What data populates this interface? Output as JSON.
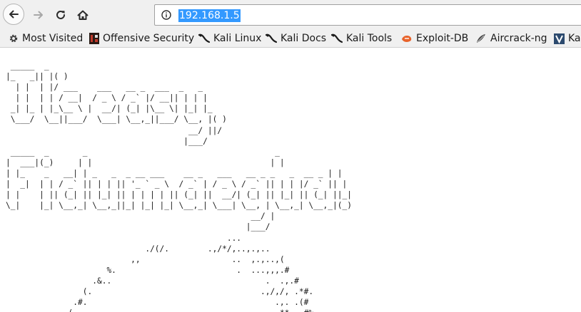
{
  "toolbar": {
    "url": "192.168.1.5",
    "icons": {
      "back": "back-arrow-icon",
      "forward": "forward-arrow-icon",
      "reload": "reload-icon",
      "home": "home-icon",
      "info": "info-icon"
    }
  },
  "bookmarks": [
    {
      "label": "Most Visited",
      "icon": "gear-icon"
    },
    {
      "label": "Offensive Security",
      "icon": "offsec-icon"
    },
    {
      "label": "Kali Linux",
      "icon": "kali-dragon-icon"
    },
    {
      "label": "Kali Docs",
      "icon": "kali-dragon-icon"
    },
    {
      "label": "Kali Tools",
      "icon": "kali-dragon-icon"
    },
    {
      "label": "Exploit-DB",
      "icon": "exploit-db-icon"
    },
    {
      "label": "Aircrack-ng",
      "icon": "aircrack-icon"
    },
    {
      "label": "Ka",
      "icon": "kali-forums-icon"
    }
  ],
  "page": {
    "ascii_art": " _____  _\n|_   _|| |( )\n  | |  | |/ ___    ___   __ _  ___  _   _\n  | |  | | / __|  / _ \\ / _` |/ __|| | | |\n _| |_ | |_\\__ \\ |  __/| (_| |\\__ \\| |_| |_\n \\___/  \\__||___/  \\___| \\__,_||___/ \\__, |( )\n                                      __/ ||/\n                                     |___/\n _____  _       _                                       _\n|  ___|(_)     | |                                     | |\n| |_    _   __| | _   _  _ __ ___    __ _   ___   __ _ _   _  __ _ | |\n|  _|  | | / _` || | | || '_ ` _ \\  / _` | / _ \\ / _` || | | |/ _` || |\n| |    | || (_| || |_| || | | | | || (_| ||  __/| (_| || |_| || (_| ||_|\n\\_|    |_| \\__,_| \\__,_||_| |_| |_| \\__,_| \\___| \\__, | \\__,_| \\__,_|(_)\n                                                   __/ |\n                                                  |___/\n                                              ...\n                             ./(/.        .,/*/,..,.,..\n                          ,,                   ..  ,.,..,(\n                     %.                         .  ...,,,.#\n                  .&..                                .  .,.#\n                (.                                   .,/,/, .*#.\n              .#.                                       .,. .(#\n             (,                                          **, .#%"
  }
}
